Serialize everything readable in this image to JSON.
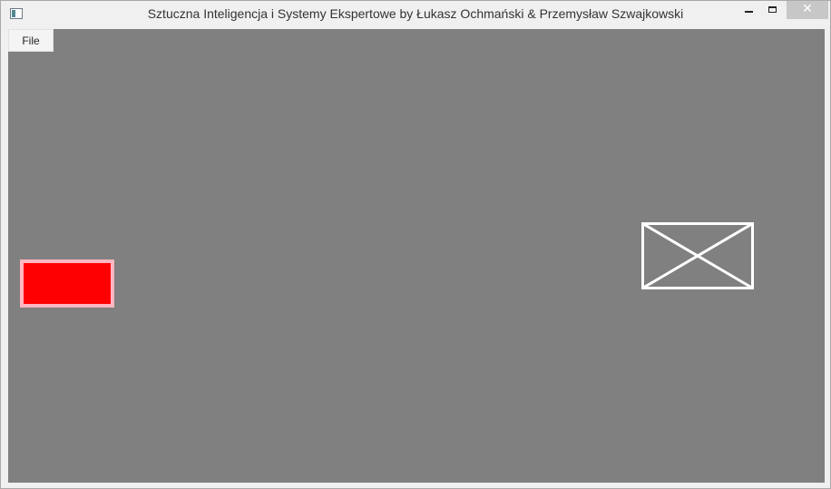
{
  "window": {
    "title": "Sztuczna Inteligencja i Systemy Ekspertowe by Łukasz Ochmański & Przemysław Szwajkowski",
    "close_glyph": "✕"
  },
  "menu": {
    "items": [
      {
        "label": "File"
      }
    ]
  },
  "canvas": {
    "background": "#808080",
    "objects": [
      {
        "name": "red-block",
        "fill": "#ff0000",
        "border": "#ffb6c1"
      },
      {
        "name": "envelope-icon",
        "stroke": "#ffffff"
      }
    ]
  }
}
